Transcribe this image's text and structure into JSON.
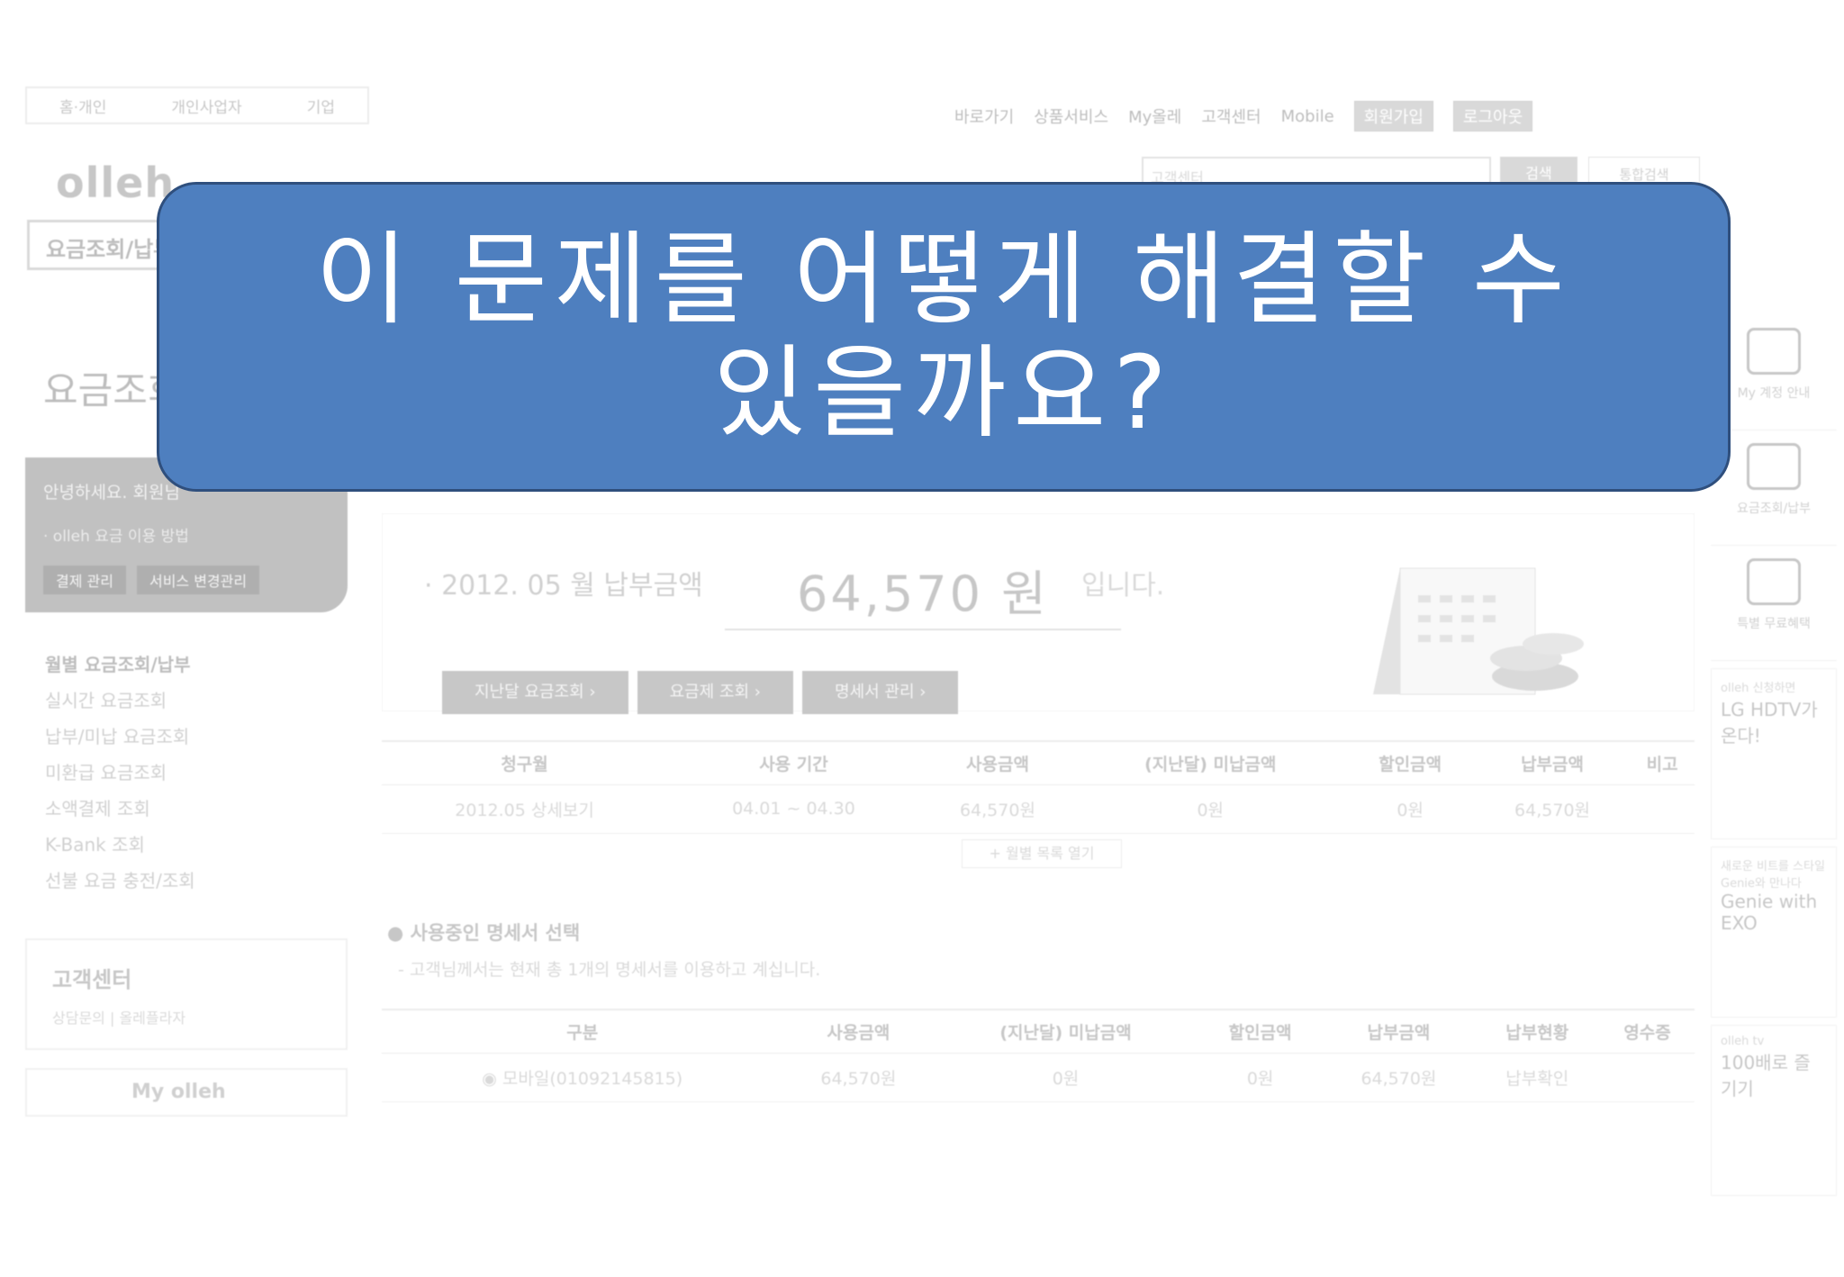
{
  "callout": {
    "line1": "이 문제를 어떻게 해결할 수",
    "line2": "있을까요?"
  },
  "top_tabs": [
    "홈·개인",
    "개인사업자",
    "기업"
  ],
  "util_nav": [
    "바로가기",
    "상품서비스",
    "My올레",
    "고객센터",
    "Mobile"
  ],
  "util_login": [
    "회원가입",
    "로그아웃"
  ],
  "logo": "olleh",
  "search": {
    "placeholder": "고객센터",
    "button": "검색",
    "extra": "통합검색"
  },
  "left_menu_top": "요금조회/납부",
  "left_title": "요금조회",
  "greeting": {
    "text": "안녕하세요. 회원님",
    "sub": "· olleh 요금 이용 방법",
    "buttons": [
      "결제 관리",
      "서비스 변경관리"
    ]
  },
  "side_links": [
    "월별 요금조회/납부",
    "실시간 요금조회",
    "납부/미납 요금조회",
    "미환급 요금조회",
    "소액결제 조회",
    "K-Bank 조회",
    "선불 요금 충전/조회"
  ],
  "cs_panel": {
    "title": "고객센터",
    "sub": "상담문의 | 올레플라자"
  },
  "my_olleh": "My olleh",
  "summary": {
    "line": "· 2012. 05 월 납부금액",
    "amount": "64,570 원",
    "ip": "입니다.",
    "buttons": [
      "지난달 요금조회 ›",
      "요금제 조회 ›",
      "명세서 관리 ›"
    ]
  },
  "bill_table": {
    "headers": [
      "청구월",
      "사용 기간",
      "사용금액",
      "(지난달) 미납금액",
      "할인금액",
      "납부금액",
      "비고"
    ],
    "rows": [
      [
        "2012.05 상세보기",
        "04.01 ~ 04.30",
        "64,570원",
        "0원",
        "0원",
        "64,570원",
        ""
      ]
    ]
  },
  "more_button": "+ 월별 목록 열기",
  "statement": {
    "title": "● 사용중인 명세서 선택",
    "sub": "- 고객님께서는 현재 총 1개의 명세서를 이용하고 계십니다.",
    "headers": [
      "구분",
      "사용금액",
      "(지난달) 미납금액",
      "할인금액",
      "납부금액",
      "납부현황",
      "영수증"
    ],
    "rows": [
      [
        "◉ 모바일(01092145815)",
        "64,570원",
        "0원",
        "0원",
        "64,570원",
        "납부확인",
        ""
      ]
    ]
  },
  "right_rail": {
    "items": [
      "My 계정 안내",
      "요금조회/납부",
      "특별 무료혜택"
    ],
    "ads": [
      {
        "small": "olleh 신청하면",
        "big": "LG HDTV가 온다!"
      },
      {
        "small": "새로운 비트를 스타일 Genie와 만나다",
        "big": "Genie with EXO"
      },
      {
        "small": "olleh tv",
        "big": "100배로 즐기기"
      }
    ]
  }
}
